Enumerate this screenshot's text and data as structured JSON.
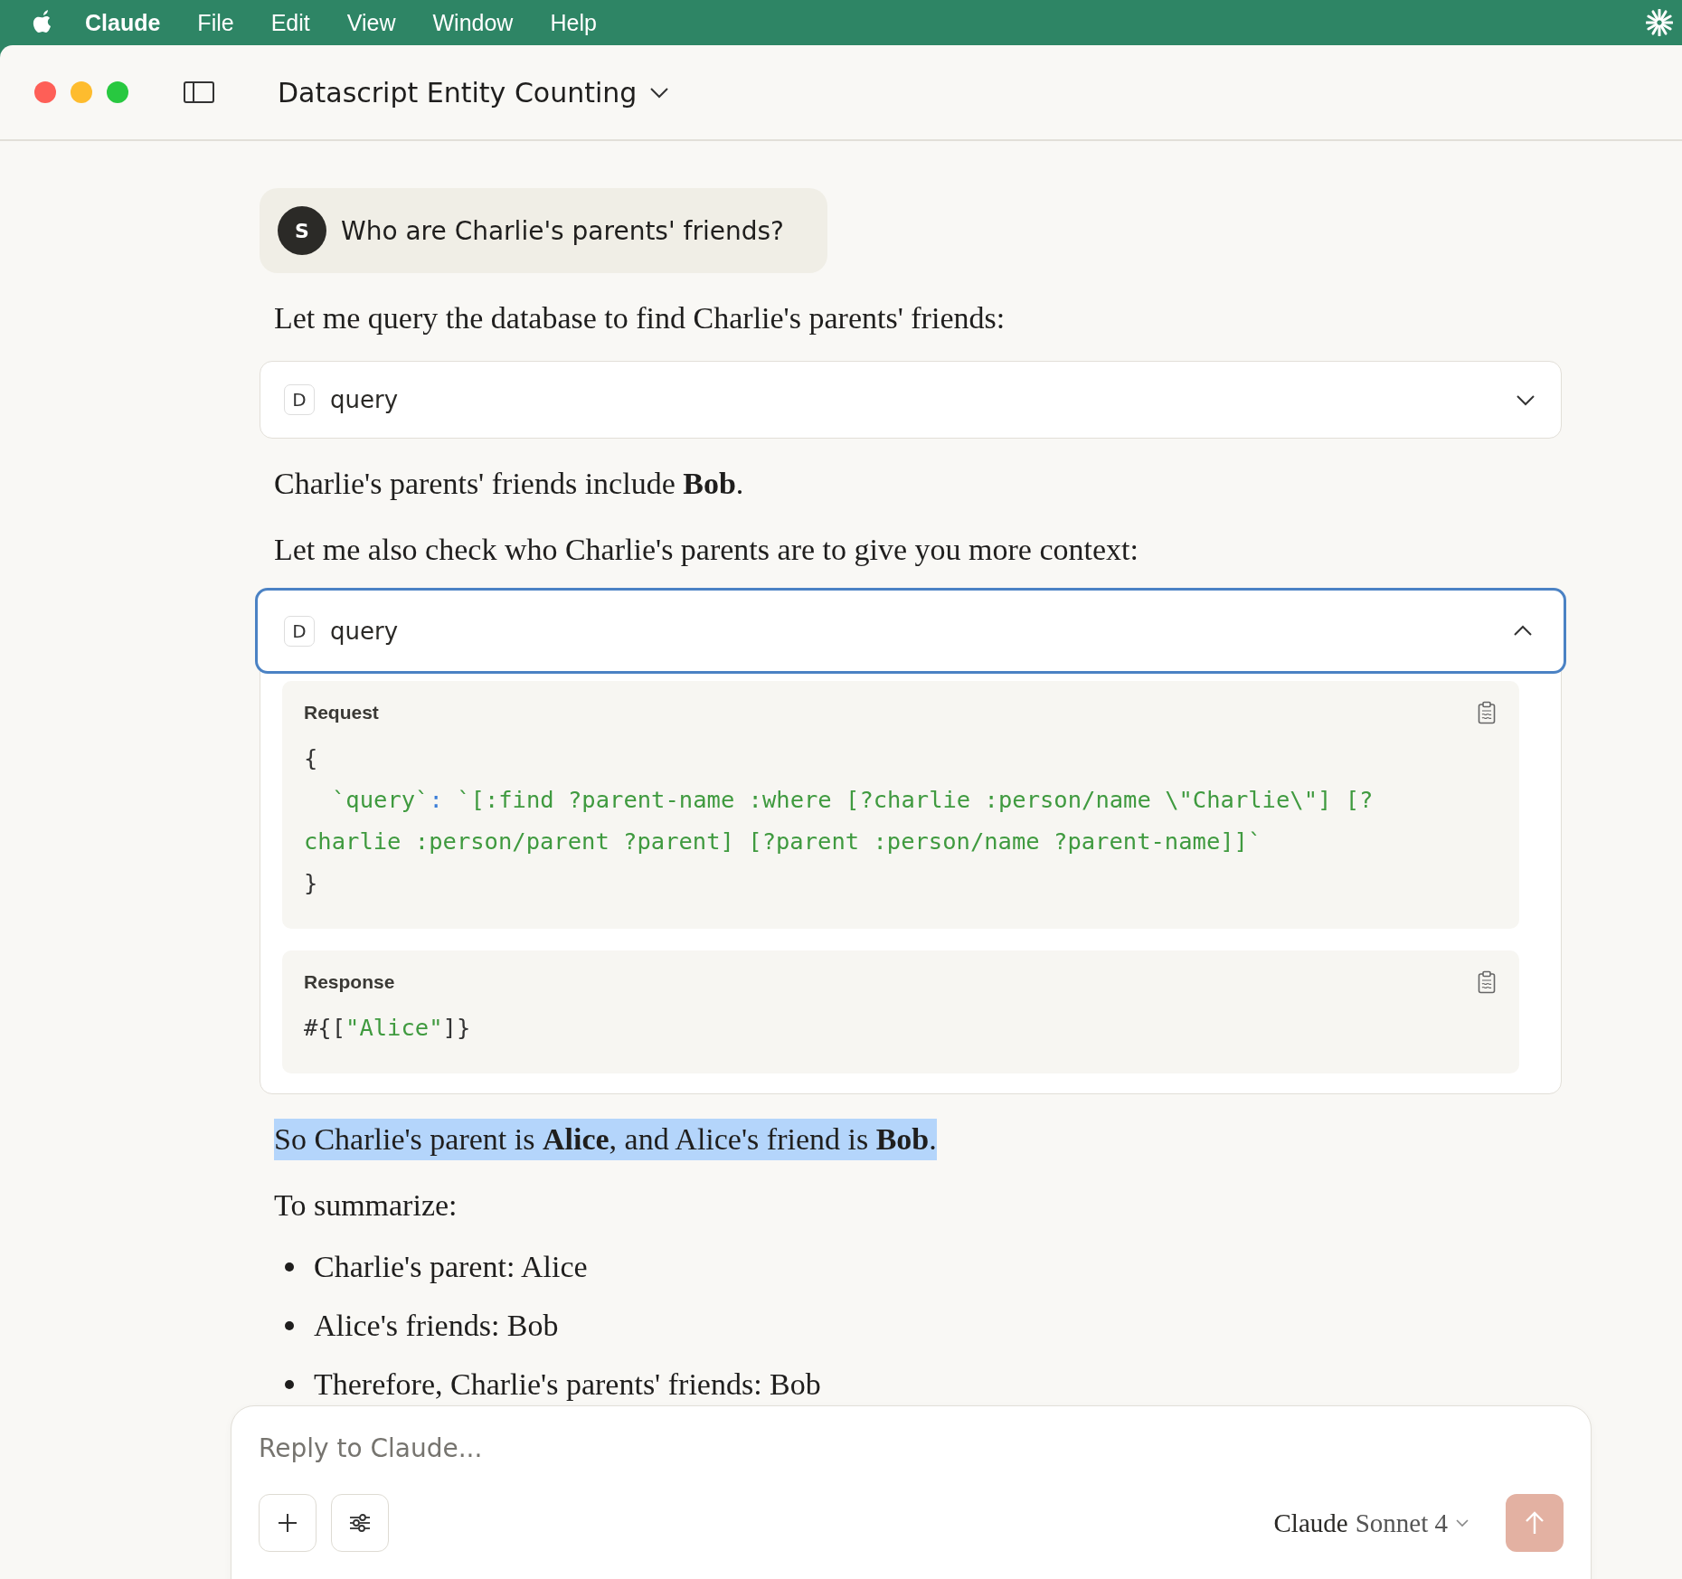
{
  "menu_bar": {
    "app_name": "Claude",
    "items": [
      "File",
      "Edit",
      "View",
      "Window",
      "Help"
    ]
  },
  "window": {
    "title": "Datascript Entity Counting"
  },
  "conversation": [
    {
      "kind": "user",
      "avatar": "S",
      "text": "Who are Charlie's parents' friends?"
    },
    {
      "kind": "paragraph",
      "text": "Let me query the database to find Charlie's parents' friends:",
      "highlighted": false
    },
    {
      "kind": "tool",
      "badge": "D",
      "name": "query",
      "expanded": false,
      "focused": false
    },
    {
      "kind": "paragraph",
      "text": "Charlie's parents' friends include **Bob**.",
      "highlighted": false
    },
    {
      "kind": "paragraph",
      "text": "Let me also check who Charlie's parents are to give you more context:",
      "highlighted": false
    },
    {
      "kind": "tool",
      "badge": "D",
      "name": "query",
      "expanded": true,
      "focused": true,
      "sections": [
        {
          "title": "Request",
          "lines": [
            [
              {
                "kind": "plain",
                "text": "{"
              }
            ],
            [
              {
                "kind": "string",
                "text": "`query`",
                "indent": true
              },
              {
                "kind": "punct",
                "text": ": "
              },
              {
                "kind": "string",
                "text": "`[:find ?parent-name :where [?charlie :person/name \\\"Charlie\\\"] [?"
              }
            ],
            [
              {
                "kind": "string",
                "text": "charlie :person/parent ?parent] [?parent :person/name ?parent-name]]`"
              }
            ],
            [
              {
                "kind": "plain",
                "text": "}"
              }
            ]
          ]
        },
        {
          "title": "Response",
          "lines": [
            [
              {
                "kind": "plain",
                "text": "#{["
              },
              {
                "kind": "string",
                "text": "\"Alice\""
              },
              {
                "kind": "plain",
                "text": "]}"
              }
            ]
          ]
        }
      ]
    },
    {
      "kind": "paragraph",
      "text": "So Charlie's parent is **Alice**, and Alice's friend is **Bob**.",
      "highlighted": true
    },
    {
      "kind": "paragraph",
      "text": "To summarize:",
      "highlighted": false
    },
    {
      "kind": "bullets",
      "items": [
        "Charlie's parent: Alice",
        "Alice's friends: Bob",
        "Therefore, Charlie's parents' friends: Bob"
      ]
    }
  ],
  "composer": {
    "placeholder": "Reply to Claude...",
    "model": {
      "brand": "Claude",
      "name": "Sonnet 4"
    },
    "send_disabled": true
  }
}
